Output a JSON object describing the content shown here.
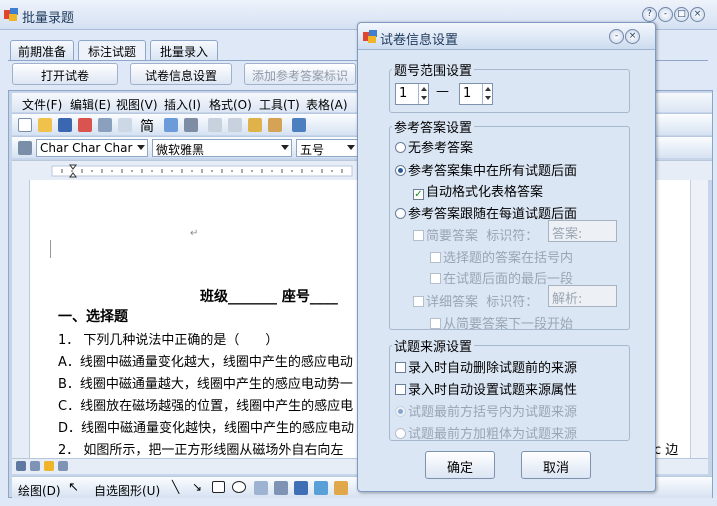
{
  "main_window": {
    "title": "批量录题",
    "tabs": [
      "前期准备",
      "标注试题",
      "批量录入"
    ],
    "toolbar_buttons": [
      "打开试卷",
      "试卷信息设置",
      "添加参考答案标识"
    ],
    "window_controls": [
      "?",
      "-",
      "□",
      "×"
    ]
  },
  "word": {
    "menus": [
      "文件(F)",
      "编辑(E)",
      "视图(V)",
      "插入(I)",
      "格式(O)",
      "工具(T)",
      "表格(A)"
    ],
    "style_box": "Char Char Char",
    "font_box": "微软雅黑",
    "size_box": "五号",
    "toolbar_text": "简",
    "drawbar": {
      "draw": "绘图(D)",
      "autoshape": "自选图形(U)"
    },
    "doc_lines": [
      "班级_______ 座号____",
      "一、选择题",
      "1． 下列几种说法中正确的是（　　）",
      "A．线圈中磁通量变化越大，线圈中产生的感应电动",
      "B．线圈中磁通量越大，线圈中产生的感应电动势一",
      "C．线圈放在磁场越强的位置，线圈中产生的感应电",
      "D．线圈中磁通量变化越快，线圈中产生的感应电动",
      "2． 如图所示，把一正方形线圈从磁场外自右向左"
    ],
    "right_text_fragment": "c 边"
  },
  "dialog": {
    "title": "试卷信息设置",
    "range_group": {
      "title": "题号范围设置",
      "from": "1",
      "to": "1",
      "dash": "—"
    },
    "answer_group": {
      "title": "参考答案设置",
      "none": "无参考答案",
      "collected": "参考答案集中在所有试题后面",
      "autoformat": "自动格式化表格答案",
      "follow": "参考答案跟随在每道试题后面",
      "brief_label": "简要答案",
      "brief_marker_label": "标识符：",
      "brief_marker": "答案:",
      "choice_in_brackets": "选择题的答案在括号内",
      "last_paragraph": "在试题后面的最后一段",
      "detail_label": "详细答案",
      "detail_marker_label": "标识符：",
      "detail_marker": "解析:",
      "from_next_paragraph": "从简要答案下一段开始"
    },
    "source_group": {
      "title": "试题来源设置",
      "auto_delete": "录入时自动删除试题前的来源",
      "auto_set": "录入时自动设置试题来源属性",
      "bracket_source": "试题最前方括号内为试题来源",
      "bold_source": "试题最前方加粗体为试题来源"
    },
    "ok": "确定",
    "cancel": "取消"
  }
}
